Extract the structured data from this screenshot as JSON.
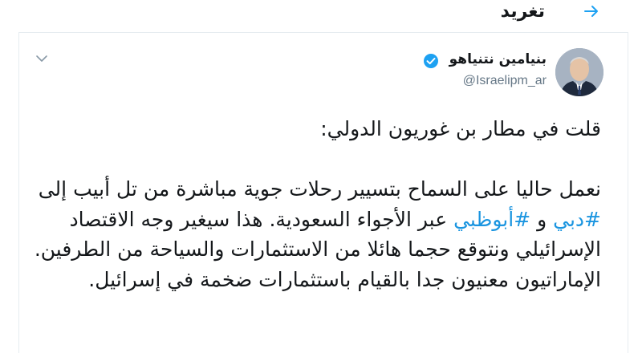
{
  "header": {
    "title": "تغريد",
    "back_icon": "arrow-right-icon",
    "accent_color": "#1da1f2"
  },
  "tweet": {
    "author": {
      "display_name": "بنيامين نتنياهو",
      "handle": "@Israelipm_ar",
      "verified": true,
      "avatar_icon": "avatar-portrait"
    },
    "menu_icon": "chevron-down-icon",
    "text": {
      "line1": "قلت في مطار بن غوريون الدولي:",
      "p2_part1": "نعمل حاليا على السماح بتسيير رحلات جوية مباشرة من تل أبيب إلى ",
      "hashtag1": "#دبي",
      "p2_part2": " و ",
      "hashtag2": "#أبوظبي",
      "p2_part3": " عبر الأجواء السعودية. هذا سيغير وجه الاقتصاد الإسرائيلي ونتوقع حجما هائلا من الاستثمارات والسياحة من الطرفين. الإماراتيون معنيون جدا بالقيام باستثمارات ضخمة في إسرائيل.",
      "hashtag_color": "#1b95e0"
    }
  }
}
